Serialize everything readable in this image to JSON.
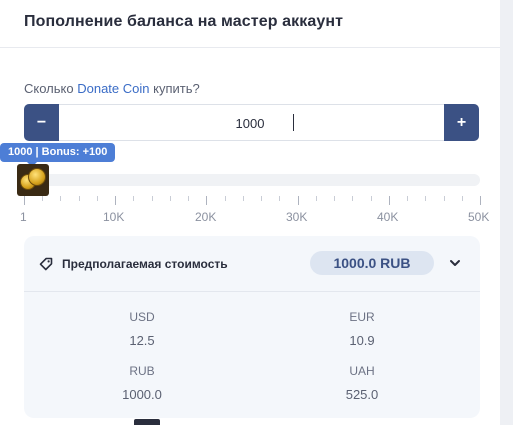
{
  "header": {
    "title": "Пополнение баланса на мастер аккаунт"
  },
  "form": {
    "question_prefix": "Сколько",
    "question_link": "Donate Coin",
    "question_suffix": "купить?",
    "minus_label": "−",
    "plus_label": "+",
    "quantity_value": "1000"
  },
  "slider": {
    "tooltip": "1000 | Bonus: +100",
    "value": 1000,
    "min": 1,
    "max": 50000,
    "scale_labels": [
      "1",
      "10K",
      "20K",
      "30K",
      "40K",
      "50K"
    ]
  },
  "cost": {
    "label": "Предполагаемая стоимость",
    "price": "1000.0 RUB",
    "currencies": [
      {
        "code": "USD",
        "value": "12.5"
      },
      {
        "code": "EUR",
        "value": "10.9"
      },
      {
        "code": "RUB",
        "value": "1000.0"
      },
      {
        "code": "UAH",
        "value": "525.0"
      }
    ]
  },
  "colors": {
    "accent": "#3b5184",
    "link": "#3a6cc6",
    "tooltip": "#4d7ed6",
    "card_bg": "#f4f7fb"
  },
  "icons": {
    "cost_tag": "tag-icon",
    "expand": "chevron-down-icon",
    "slider_thumb": "gold-coins-icon"
  }
}
